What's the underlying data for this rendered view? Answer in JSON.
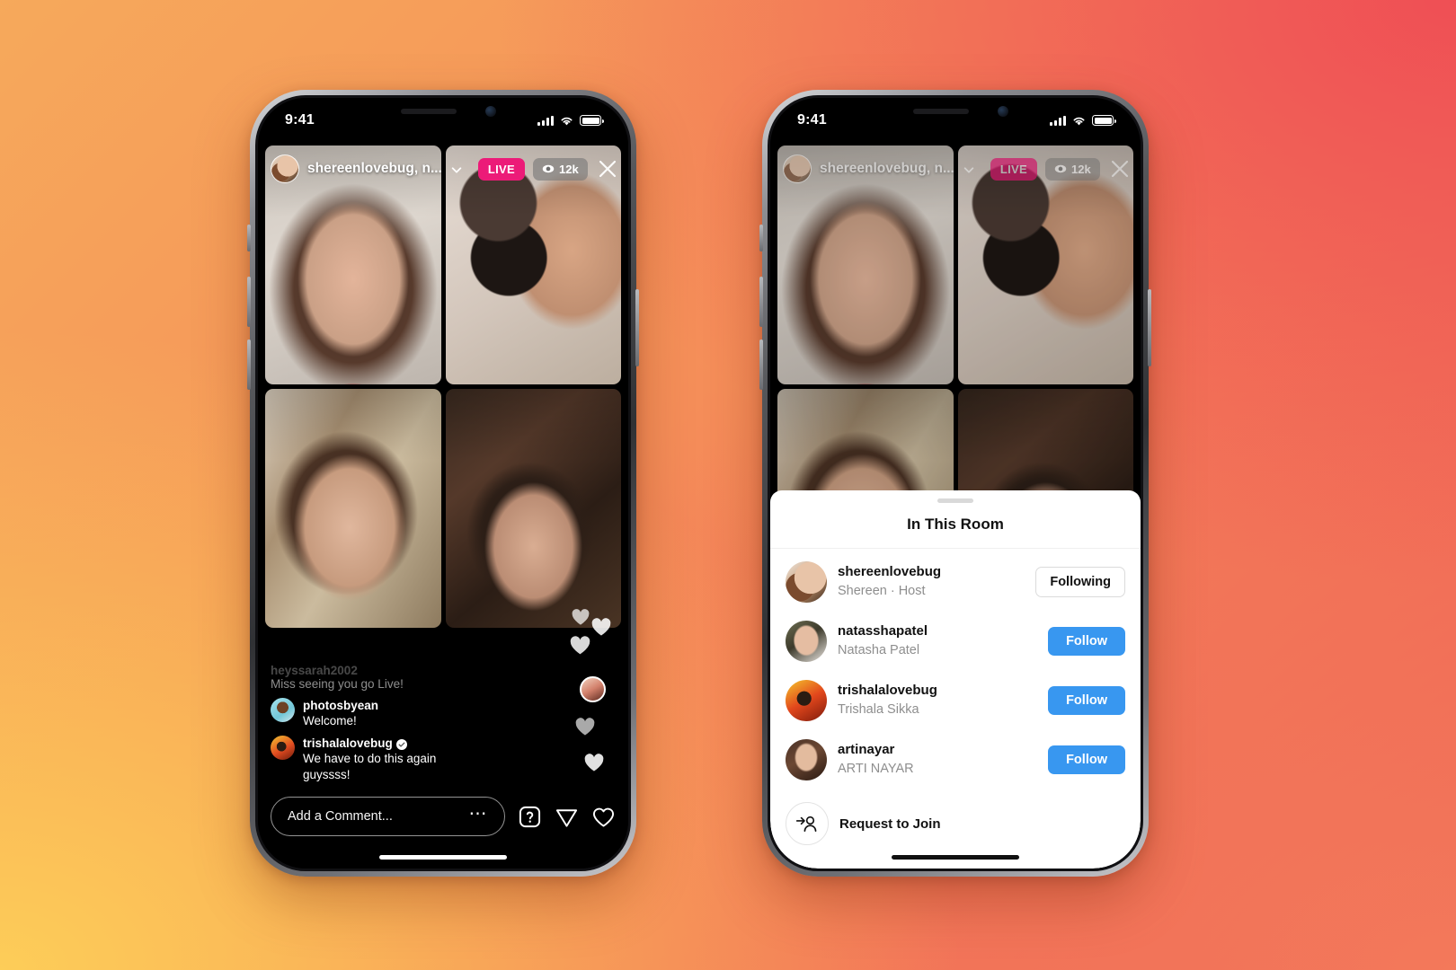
{
  "background": {
    "colors": {
      "top_left": "#f6a95b",
      "top_right": "#ef4f55",
      "bottom_left": "#fdcd58",
      "bottom_right": "#f3795a"
    }
  },
  "theme": {
    "live_badge_color": "#ec1b78",
    "follow_button_color": "#3897f0",
    "sheet_background": "#ffffff",
    "secondary_text": "#8e8e8e"
  },
  "status_bar": {
    "time": "9:41",
    "cellular_icon": "signal-bars-icon",
    "wifi_icon": "wifi-icon",
    "battery_icon": "battery-icon"
  },
  "live_header": {
    "host_avatar": "host-avatar",
    "title": "shereenlovebug, n...",
    "chevron_icon": "chevron-down-icon",
    "live_label": "LIVE",
    "viewer_icon": "eye-icon",
    "viewer_count": "12k",
    "close_icon": "close-icon"
  },
  "video_grid": {
    "tiles": [
      {
        "name": "tile-host-shereen"
      },
      {
        "name": "tile-makeup-compact"
      },
      {
        "name": "tile-eye-makeup"
      },
      {
        "name": "tile-dark-room"
      }
    ]
  },
  "comments": [
    {
      "username": "heyssarah2002",
      "text": "Miss seeing you go Live!",
      "faded": true,
      "verified": false
    },
    {
      "username": "photosbyean",
      "text": "Welcome!",
      "faded": false,
      "verified": false
    },
    {
      "username": "trishalalovebug",
      "text": "We have to do this again guyssss!",
      "faded": false,
      "verified": true
    }
  ],
  "bottom_bar": {
    "comment_placeholder": "Add a Comment...",
    "more_icon": "ellipsis-icon",
    "questions_icon": "question-mark-icon",
    "share_icon": "send-paper-plane-icon",
    "like_icon": "heart-icon"
  },
  "hearts": {
    "icon": "floating-heart-icon",
    "count": 5,
    "avatar_bubble": "heart-sender-avatar"
  },
  "room_sheet": {
    "handle": "sheet-drag-handle",
    "title": "In This Room",
    "members": [
      {
        "username": "shereenlovebug",
        "subtitle": "Shereen · Host",
        "action_label": "Following",
        "action_state": "following"
      },
      {
        "username": "natasshapatel",
        "subtitle": "Natasha Patel",
        "action_label": "Follow",
        "action_state": "follow"
      },
      {
        "username": "trishalalovebug",
        "subtitle": "Trishala Sikka",
        "action_label": "Follow",
        "action_state": "follow"
      },
      {
        "username": "artinayar",
        "subtitle": "ARTI NAYAR",
        "action_label": "Follow",
        "action_state": "follow"
      }
    ],
    "request_to_join": {
      "icon": "add-person-icon",
      "label": "Request to Join"
    }
  }
}
